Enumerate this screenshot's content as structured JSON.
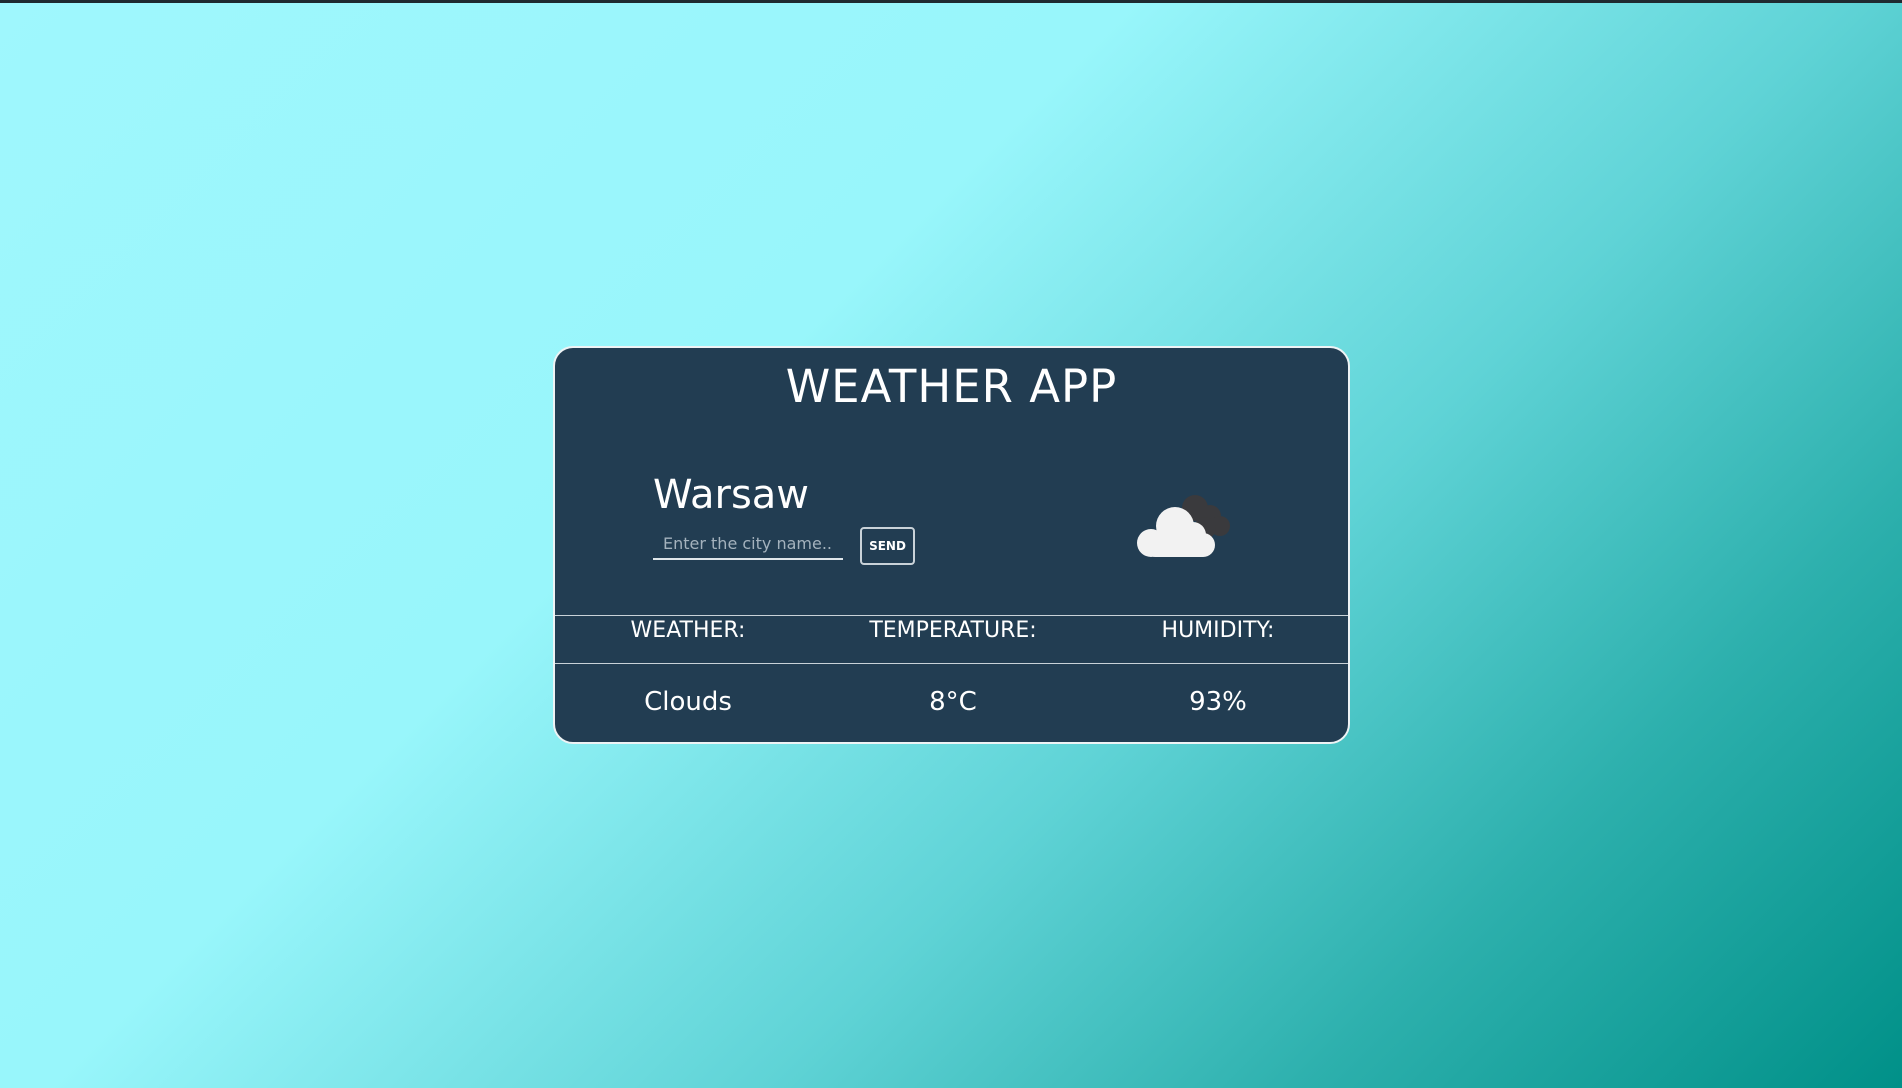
{
  "app": {
    "title": "WEATHER APP"
  },
  "search": {
    "city": "Warsaw",
    "input_value": "",
    "placeholder": "Enter the city name...",
    "send_label": "SEND"
  },
  "icon": {
    "condition": "clouds-icon"
  },
  "table": {
    "headers": [
      "WEATHER:",
      "TEMPERATURE:",
      "HUMIDITY:"
    ],
    "values": [
      "Clouds",
      "8°C",
      "93%"
    ]
  },
  "colors": {
    "card_background": "#223d52",
    "background_gradient_start": "#9ff7fd",
    "background_gradient_end": "#009088"
  }
}
